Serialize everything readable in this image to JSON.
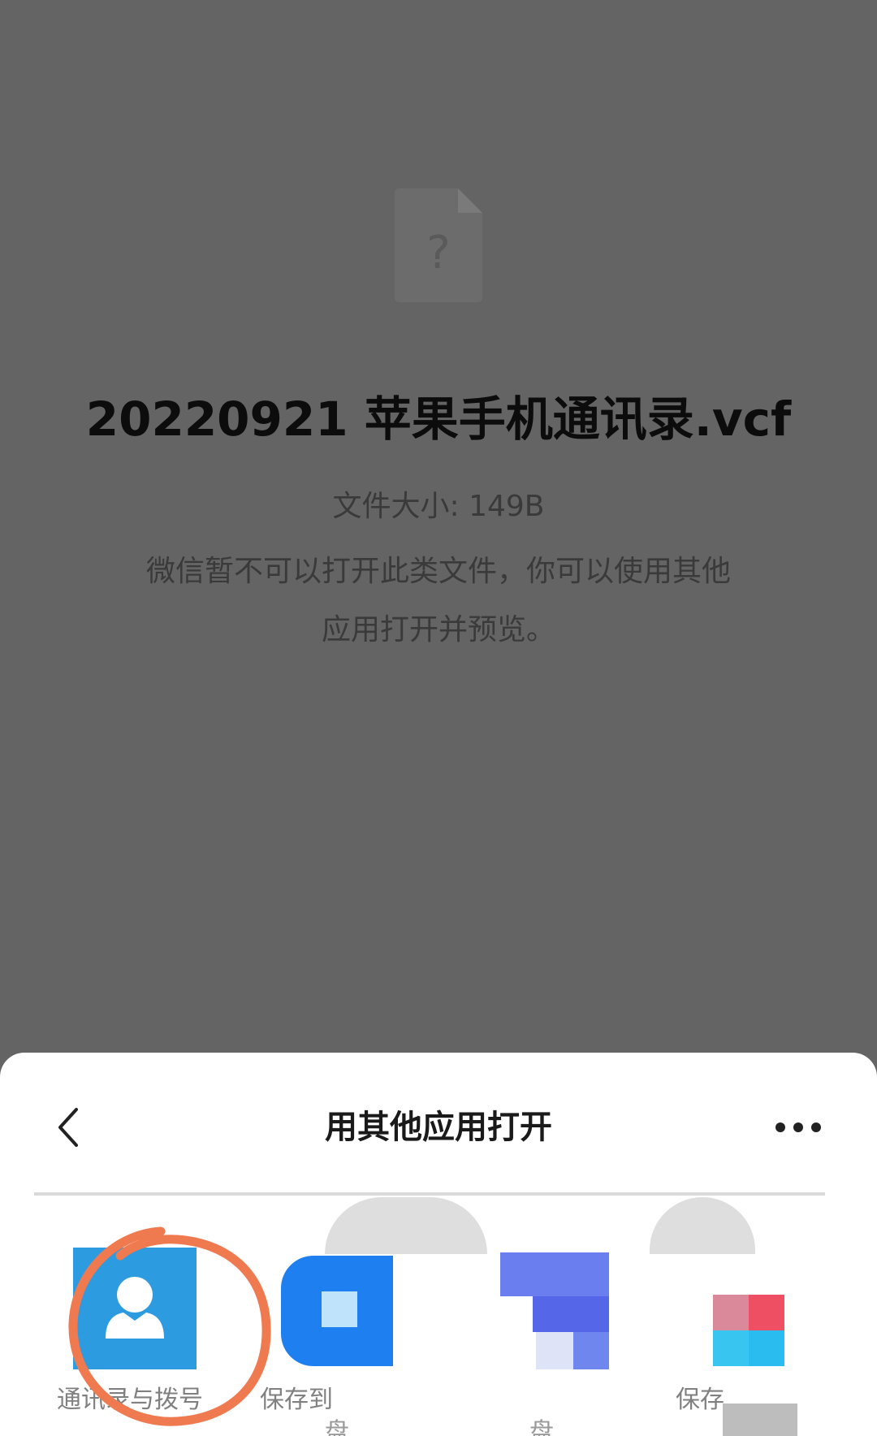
{
  "file": {
    "name": "20220921 苹果手机通讯录.vcf",
    "size_label": "文件大小: 149B",
    "message": "微信暂不可以打开此类文件，你可以使用其他应用打开并预览。",
    "icon": "unknown-file-icon"
  },
  "sheet": {
    "title": "用其他应用打开",
    "back_icon": "chevron-left-icon",
    "more_icon": "ellipsis-icon"
  },
  "apps": [
    {
      "label": "通讯录与拨号",
      "icon": "contact-person-icon",
      "color": "#2d9be0"
    },
    {
      "label": "保存到",
      "sublabel": "盘",
      "icon": "save-to-cloud-icon",
      "color": "#1e7ff0"
    },
    {
      "label": "",
      "sublabel": "盘",
      "icon": "cloud-drive-icon",
      "color": "#5b6ef5"
    },
    {
      "label": "保存",
      "icon": "app-icon-pixelated",
      "color": "#e8495e"
    }
  ],
  "colors": {
    "overlay": "#646464",
    "annotation": "#f07a50"
  }
}
